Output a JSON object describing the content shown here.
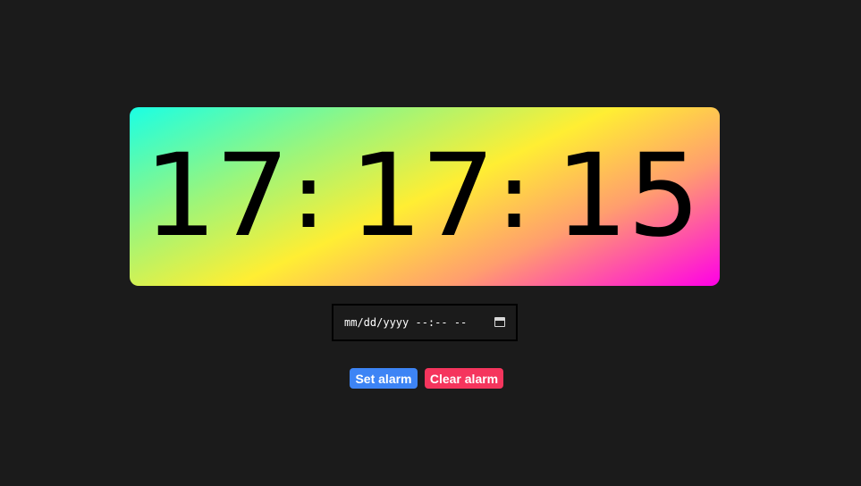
{
  "clock": {
    "hours": "17",
    "separator_1": ":",
    "minutes": "17",
    "separator_2": ":",
    "seconds": "15"
  },
  "alarm_input": {
    "placeholder_text": "mm/dd/yyyy --:-- --",
    "icon": "calendar-icon"
  },
  "buttons": {
    "set_label": "Set alarm",
    "clear_label": "Clear alarm"
  },
  "colors": {
    "background": "#1b1b1b",
    "gradient_start": "#1affe4",
    "gradient_mid": "#ffee33",
    "gradient_end": "#ff00e6",
    "set_button": "#3d84f5",
    "clear_button": "#f5355d"
  }
}
